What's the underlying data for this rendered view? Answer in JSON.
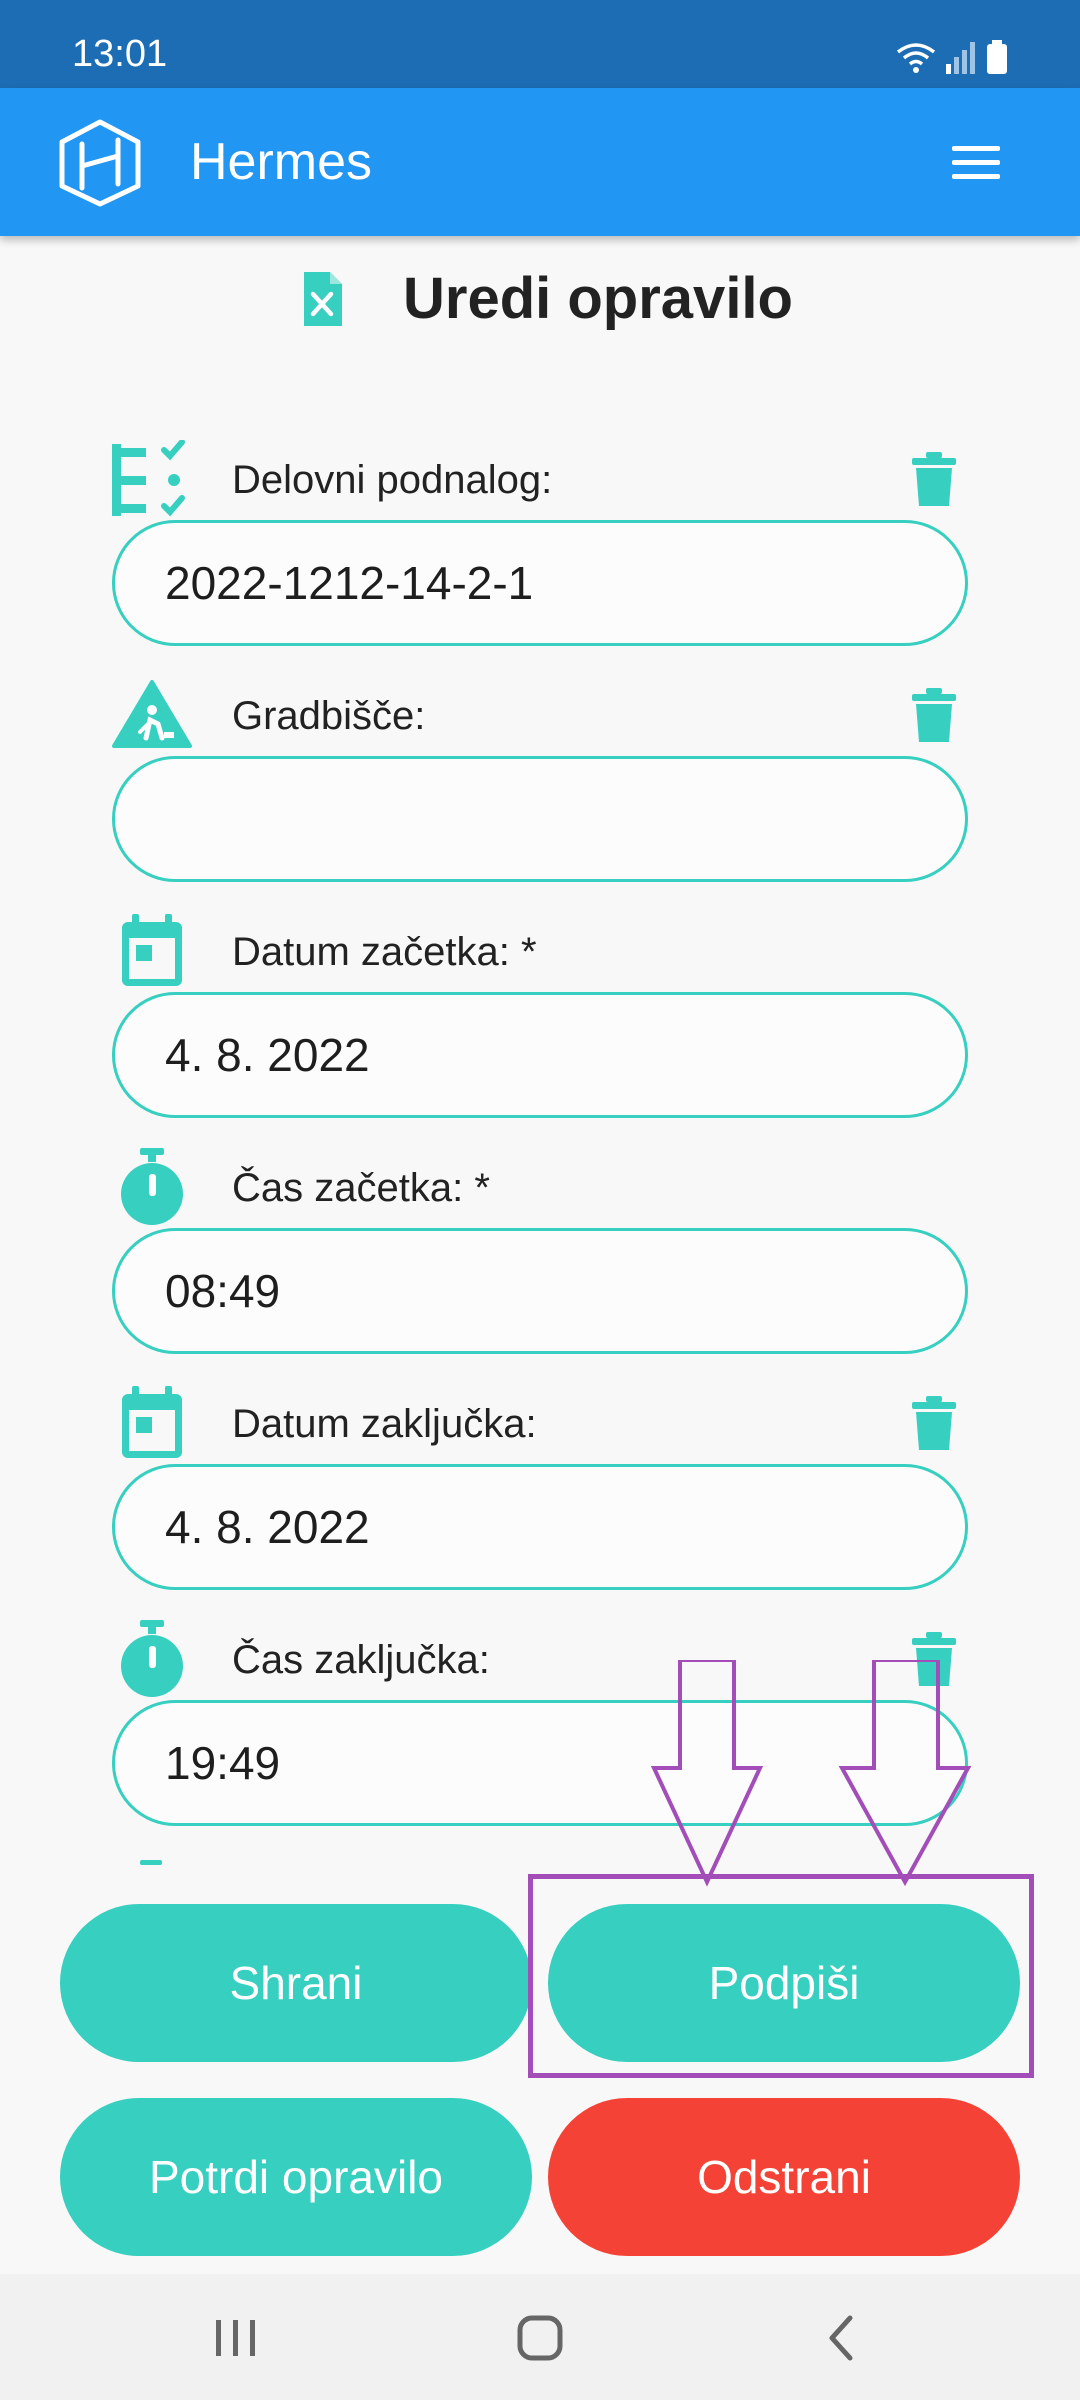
{
  "status_bar": {
    "time": "13:01",
    "icons": [
      "wifi-icon",
      "signal-icon",
      "battery-icon"
    ]
  },
  "app_bar": {
    "title": "Hermes",
    "logo_icon": "hermes-logo-icon",
    "menu_icon": "hamburger-menu-icon"
  },
  "page": {
    "title": "Uredi opravilo",
    "title_icon": "task-file-icon"
  },
  "fields": [
    {
      "label": "Delovni podnalog:",
      "value": "2022-1212-14-2-1",
      "icon": "checklist-icon",
      "deletable": true
    },
    {
      "label": "Gradbišče:",
      "value": "",
      "icon": "construction-sign-icon",
      "deletable": true
    },
    {
      "label": "Datum začetka: *",
      "value": "4. 8. 2022",
      "icon": "calendar-icon",
      "deletable": false
    },
    {
      "label": "Čas začetka: *",
      "value": "08:49",
      "icon": "stopwatch-icon",
      "deletable": false
    },
    {
      "label": "Datum zaključka:",
      "value": "4. 8. 2022",
      "icon": "calendar-icon",
      "deletable": true
    },
    {
      "label": "Čas zaključka:",
      "value": "19:49",
      "icon": "stopwatch-icon",
      "deletable": true
    }
  ],
  "buttons": {
    "save": "Shrani",
    "sign": "Podpiši",
    "confirm": "Potrdi opravilo",
    "remove": "Odstrani"
  },
  "colors": {
    "app_bar": "#2196f3",
    "status_bar": "#1d6db5",
    "accent": "#36cfc0",
    "danger": "#f44336",
    "annotation": "#a24db8"
  },
  "nav_bar": {
    "icons": [
      "recent-apps-icon",
      "home-icon",
      "back-icon"
    ]
  }
}
